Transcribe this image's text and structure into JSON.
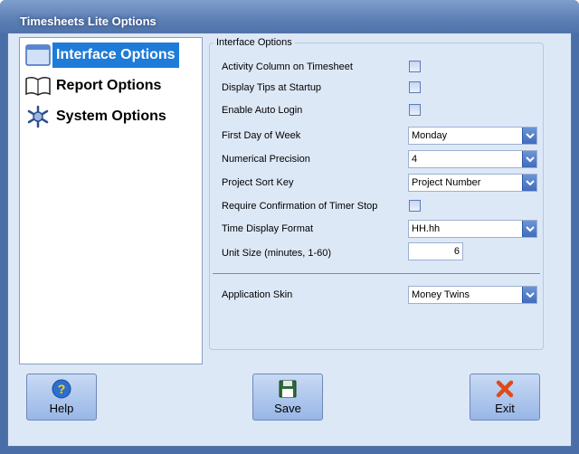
{
  "window": {
    "title": "Timesheets Lite Options"
  },
  "nav": {
    "items": [
      {
        "label": "Interface Options",
        "icon": "window-icon",
        "selected": true
      },
      {
        "label": "Report Options",
        "icon": "book-icon",
        "selected": false
      },
      {
        "label": "System Options",
        "icon": "gear-icon",
        "selected": false
      }
    ]
  },
  "group": {
    "caption": "Interface Options",
    "activity_column": {
      "label": "Activity Column on Timesheet",
      "checked": false
    },
    "display_tips": {
      "label": "Display Tips at Startup",
      "checked": false
    },
    "auto_login": {
      "label": "Enable Auto Login",
      "checked": false
    },
    "first_day": {
      "label": "First Day of Week",
      "value": "Monday"
    },
    "precision": {
      "label": "Numerical Precision",
      "value": "4"
    },
    "sort_key": {
      "label": "Project Sort Key",
      "value": "Project Number"
    },
    "confirm_stop": {
      "label": "Require Confirmation of Timer Stop",
      "checked": false
    },
    "time_format": {
      "label": "Time Display Format",
      "value": "HH.hh"
    },
    "unit_size": {
      "label": "Unit Size (minutes, 1-60)",
      "value": "6"
    },
    "skin": {
      "label": "Application Skin",
      "value": "Money Twins"
    }
  },
  "buttons": {
    "help": "Help",
    "save": "Save",
    "exit": "Exit"
  },
  "colors": {
    "selection": "#1e7bd8",
    "client_bg": "#dde8f7",
    "title_bar": "#5c7fb5"
  }
}
